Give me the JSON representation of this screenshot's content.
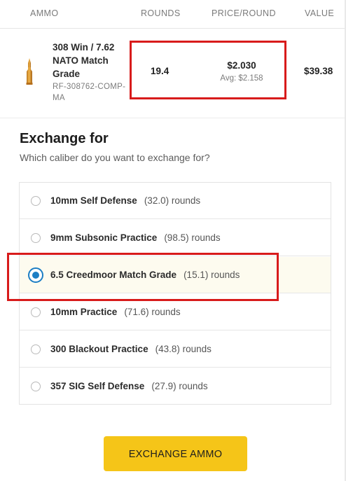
{
  "table_header": {
    "ammo": "AMMO",
    "rounds": "ROUNDS",
    "price_per_round": "PRICE/ROUND",
    "value": "VALUE"
  },
  "product": {
    "name": "308 Win / 7.62 NATO Match Grade",
    "sku": "RF-308762-COMP-MA",
    "icon": "rifle-cartridge-icon",
    "rounds": "19.4",
    "price": "$2.030",
    "avg_price": "Avg: $2.158",
    "value": "$39.38"
  },
  "exchange": {
    "title": "Exchange for",
    "subtitle": "Which caliber do you want to exchange for?",
    "options": [
      {
        "name": "10mm Self Defense",
        "rounds": "(32.0) rounds",
        "selected": false
      },
      {
        "name": "9mm Subsonic Practice",
        "rounds": "(98.5) rounds",
        "selected": false
      },
      {
        "name": "6.5 Creedmoor Match Grade",
        "rounds": "(15.1) rounds",
        "selected": true
      },
      {
        "name": "10mm Practice",
        "rounds": "(71.6) rounds",
        "selected": false
      },
      {
        "name": "300 Blackout Practice",
        "rounds": "(43.8) rounds",
        "selected": false
      },
      {
        "name": "357 SIG Self Defense",
        "rounds": "(27.9) rounds",
        "selected": false
      }
    ],
    "button_label": "EXCHANGE AMMO"
  },
  "colors": {
    "accent_button": "#f5c518",
    "radio_selected": "#1c7ec4",
    "highlight_box": "#d81b1b",
    "selected_row_bg": "#fdfbef"
  }
}
